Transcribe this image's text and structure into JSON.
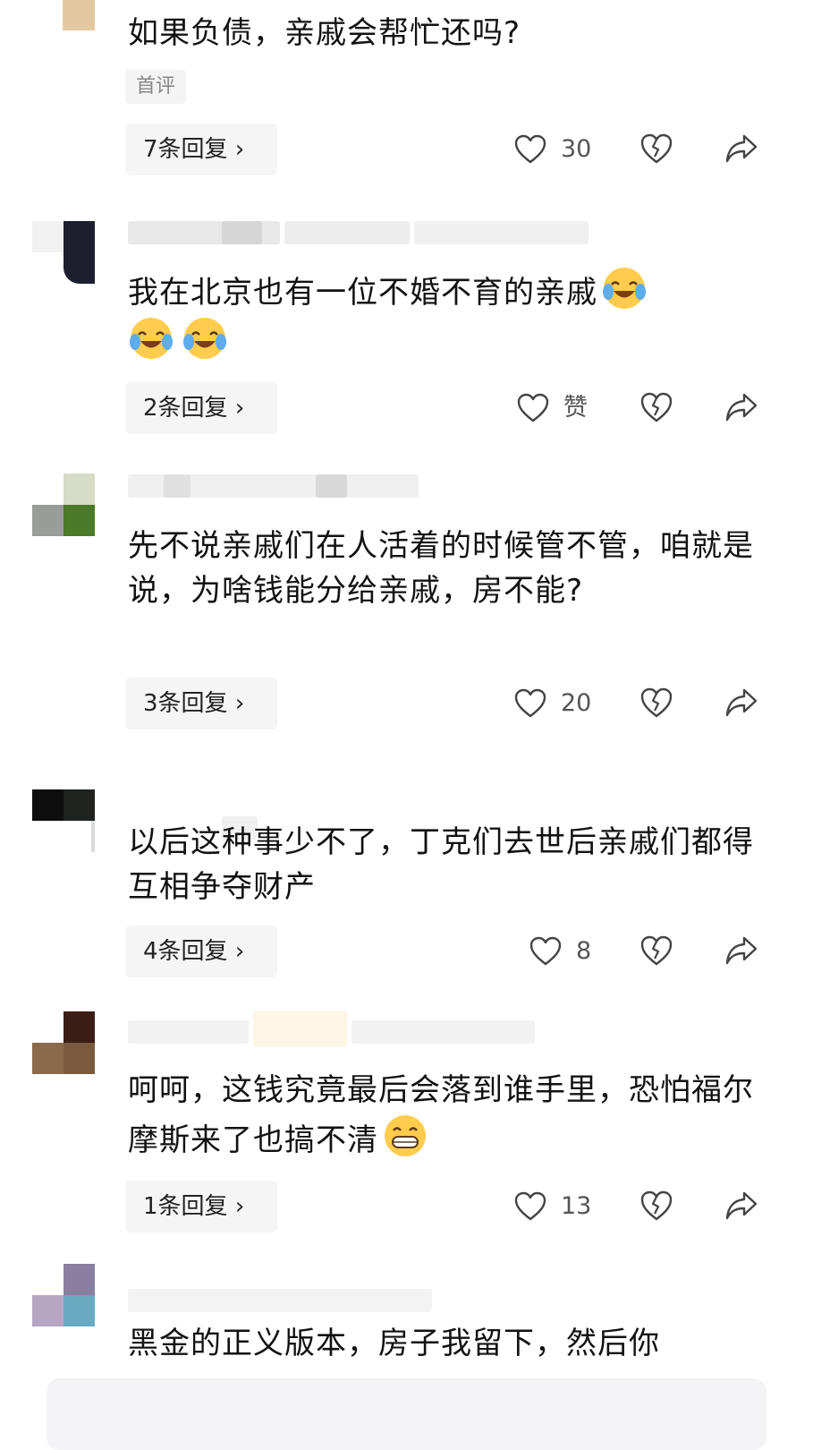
{
  "comments": [
    {
      "text": "如果负债，亲戚会帮忙还吗?",
      "tag": "首评",
      "replies_label": "7条回复",
      "likes": "30"
    },
    {
      "text": "我在北京也有一位不婚不育的亲戚",
      "emojis": [
        "laughing-cry-emoji",
        "laughing-cry-emoji",
        "laughing-cry-emoji"
      ],
      "replies_label": "2条回复",
      "likes": "赞"
    },
    {
      "text": "先不说亲戚们在人活着的时候管不管，咱就是说，为啥钱能分给亲戚，房不能?",
      "replies_label": "3条回复",
      "likes": "20"
    },
    {
      "text": "以后这种事少不了，丁克们去世后亲戚们都得互相争夺财产",
      "replies_label": "4条回复",
      "likes": "8"
    },
    {
      "text": "呵呵，这钱究竟最后会落到谁手里，恐怕福尔摩斯来了也搞不清",
      "emojis": [
        "grin-emoji"
      ],
      "replies_label": "1条回复",
      "likes": "13"
    },
    {
      "text": "黑金的正义版本，房子我留下，然后你"
    }
  ],
  "icons": {
    "like": "heart-outline-icon",
    "dislike": "broken-heart-icon",
    "share": "share-arrow-icon",
    "chevron": "chevron-right-icon"
  },
  "colors": {
    "reply_bg": "#f5f5f5",
    "icon_stroke": "#444444",
    "text": "#121212",
    "secondary": "#555555"
  }
}
